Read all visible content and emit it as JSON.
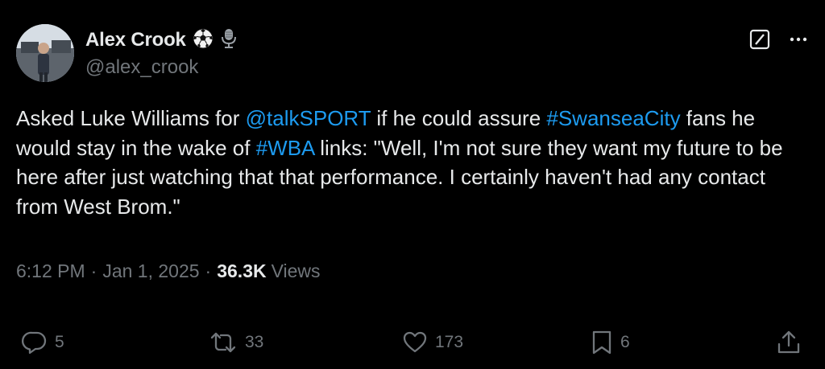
{
  "author": {
    "display_name": "Alex Crook",
    "handle": "@alex_crook",
    "badge_icons": [
      "soccer-ball-icon",
      "microphone-icon"
    ]
  },
  "tweet": {
    "segments": [
      {
        "text": "Asked Luke Williams for ",
        "link": false
      },
      {
        "text": "@talkSPORT",
        "link": true
      },
      {
        "text": " if he could assure ",
        "link": false
      },
      {
        "text": "#SwanseaCity",
        "link": true
      },
      {
        "text": " fans he would stay in the wake of ",
        "link": false
      },
      {
        "text": "#WBA",
        "link": true
      },
      {
        "text": " links: \"Well, I'm not sure they want my future to be here after just watching that that performance. I certainly haven't had any contact from West Brom.\"",
        "link": false
      }
    ]
  },
  "meta": {
    "time": "6:12 PM",
    "separator": "·",
    "date": "Jan 1, 2025",
    "views_count": "36.3K",
    "views_label": "Views"
  },
  "actions": {
    "replies": "5",
    "reposts": "33",
    "likes": "173",
    "bookmarks": "6"
  },
  "colors": {
    "background": "#000000",
    "text": "#e7e9ea",
    "secondary": "#71767b",
    "link": "#1d9bf0"
  }
}
